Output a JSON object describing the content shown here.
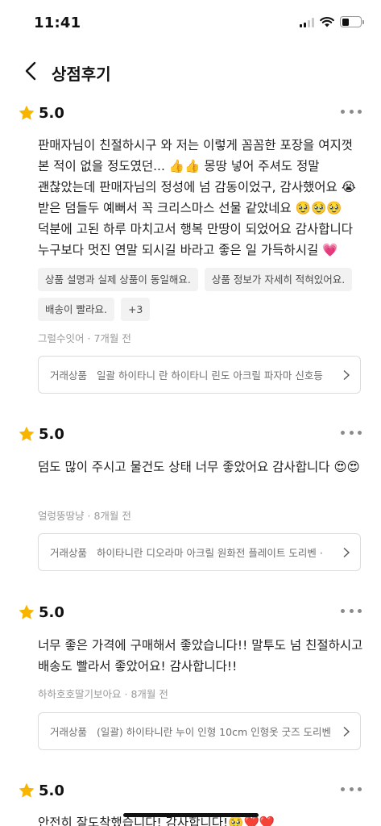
{
  "status_bar": {
    "time": "11:41",
    "battery_level": 0.4
  },
  "header": {
    "title": "상점후기"
  },
  "colors": {
    "star": "#f7b500",
    "tag_bg": "#f2f2f2",
    "border": "#dcdcdc"
  },
  "reviews": [
    {
      "score": "5.0",
      "text": "판매자님이 친절하시구 와 저는 이렇게 꼼꼼한 포장을 여지껏 본 적이 없을 정도였던... 👍👍 몽땅 넣어 주셔도 정말 괜찮았는데 판매자님의 정성에 넘 감동이었구, 감사했어요 😭 받은 덤들두 예뻐서 꼭 크리스마스 선물 같았네요 🥹🥹🥹 덕분에 고된 하루 마치고서 행복 만땅이 되었어요 감사합니다 누구보다 멋진 연말 되시길 바라고 좋은 일 가득하시길 💗",
      "tags": [
        "상품 설명과 실제 상품이 동일해요.",
        "상품 정보가 자세히 적혀있어요.",
        "배송이 빨라요.",
        "+3"
      ],
      "author": "그럴수잇어",
      "time_ago": "7개월 전",
      "product_label": "거래상품",
      "product_name": "일괄 하이타니 란 하이타니 린도 아크릴 파자마 신호등"
    },
    {
      "score": "5.0",
      "text": "덤도 많이 주시고 물건도 상태 너무 좋았어요 감사합니다 😍😍",
      "tags": [],
      "author": "얼렁뚱땅냥",
      "time_ago": "8개월 전",
      "product_label": "거래상품",
      "product_name": "하이타니란 디오라마 아크릴 원화전 플레이트 도리벤 ·"
    },
    {
      "score": "5.0",
      "text": "너무 좋은 가격에 구매해서 좋았습니다!! 말투도 넘 친절하시고 배송도 빨라서 좋았어요! 감사합니다!!",
      "tags": [],
      "author": "하하호호딸기보아요",
      "time_ago": "8개월 전",
      "product_label": "거래상품",
      "product_name": "(일괄) 하이타니란 누이 인형 10cm 인형옷 굿즈 도리벤"
    },
    {
      "score": "5.0",
      "text": "안전히 잘도착했습니다! 감사합니다!🥹❤️❤️",
      "tags": [],
      "author": "",
      "time_ago": "",
      "product_label": "",
      "product_name": ""
    }
  ]
}
